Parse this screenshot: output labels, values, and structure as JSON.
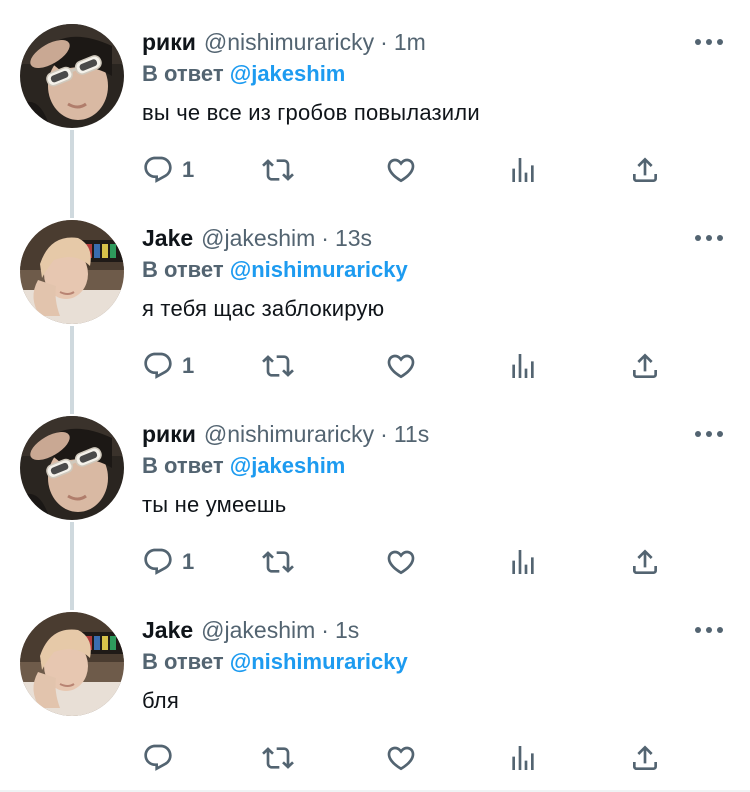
{
  "tweets": [
    {
      "author": "рики",
      "handle": "@nishimuraricky",
      "separator": "·",
      "time": "1m",
      "reply_prefix": "В ответ",
      "reply_to": "@jakeshim",
      "text": "вы че все из гробов повылазили",
      "reply_count": "1",
      "avatar": "avatar-riki"
    },
    {
      "author": "Jake",
      "handle": "@jakeshim",
      "separator": "·",
      "time": "13s",
      "reply_prefix": "В ответ",
      "reply_to": "@nishimuraricky",
      "text": "я тебя щас заблокирую",
      "reply_count": "1",
      "avatar": "avatar-jake"
    },
    {
      "author": "рики",
      "handle": "@nishimuraricky",
      "separator": "·",
      "time": "11s",
      "reply_prefix": "В ответ",
      "reply_to": "@jakeshim",
      "text": "ты не умеешь",
      "reply_count": "1",
      "avatar": "avatar-riki"
    },
    {
      "author": "Jake",
      "handle": "@jakeshim",
      "separator": "·",
      "time": "1s",
      "reply_prefix": "В ответ",
      "reply_to": "@nishimuraricky",
      "text": "бля",
      "reply_count": "",
      "avatar": "avatar-jake"
    }
  ],
  "icons": {
    "reply": "reply-bubble-icon",
    "retweet": "retweet-icon",
    "like": "heart-icon",
    "views": "analytics-bars-icon",
    "share": "share-upload-icon",
    "more": "more-dots-icon"
  },
  "colors": {
    "accent": "#1d9bf0",
    "secondary_text": "#536471",
    "primary_text": "#0f1419",
    "thread_line": "#cfd9de"
  }
}
